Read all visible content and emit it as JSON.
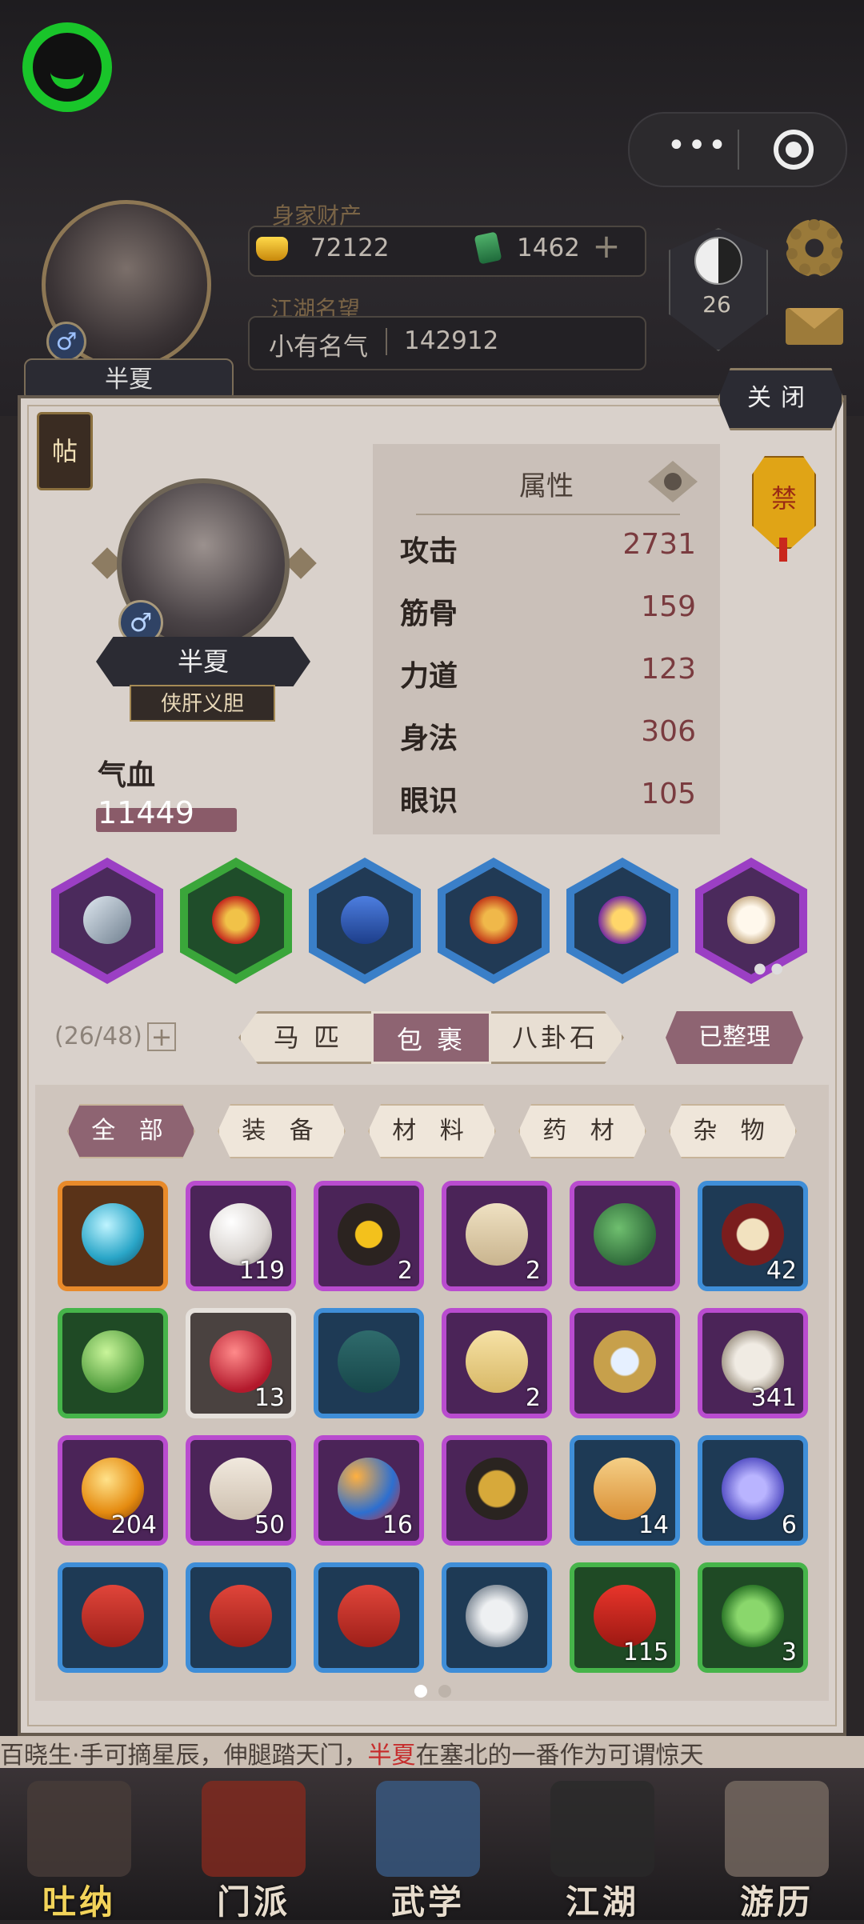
{
  "hud": {
    "assets_label": "身家财产",
    "gold": "72122",
    "jade": "1462",
    "plus": "+",
    "fame_label": "江湖名望",
    "fame_title": "小有名气",
    "fame_value": "142912",
    "player_name": "半夏",
    "gender": "♂",
    "taiji_level": "26",
    "menu_dots": "•••"
  },
  "panel": {
    "close": "关闭",
    "tie_icon": "帖",
    "ban_icon": "禁",
    "character": {
      "name": "半夏",
      "gender": "♂",
      "title": "侠肝义胆",
      "hp_label": "气血",
      "hp_value": "11449"
    },
    "attributes": {
      "title": "属性",
      "rows": [
        {
          "label": "攻击",
          "value": "2731"
        },
        {
          "label": "筋骨",
          "value": "159"
        },
        {
          "label": "力道",
          "value": "123"
        },
        {
          "label": "身法",
          "value": "306"
        },
        {
          "label": "眼识",
          "value": "105"
        }
      ]
    },
    "equipment": [
      {
        "slot": "weapon",
        "icon": "sword-icon",
        "rarity": "purple"
      },
      {
        "slot": "armor",
        "icon": "armor-icon",
        "rarity": "green"
      },
      {
        "slot": "belt",
        "icon": "belt-icon",
        "rarity": "blue"
      },
      {
        "slot": "boots",
        "icon": "boots-icon",
        "rarity": "blue"
      },
      {
        "slot": "accessory",
        "icon": "pendant-icon",
        "rarity": "blue"
      },
      {
        "slot": "mount",
        "icon": "horse-icon",
        "rarity": "purple"
      }
    ],
    "bag": {
      "count": "(26/48)",
      "add": "+",
      "tabs": [
        "马 匹",
        "包 裹",
        "八卦石"
      ],
      "active_tab": 1,
      "sorted_button": "已整理",
      "filters": [
        "全 部",
        "装 备",
        "材 料",
        "药 材",
        "杂 物"
      ],
      "active_filter": 0
    },
    "items": [
      {
        "icon": "blue-egg-icon",
        "rarity": "orange",
        "count": ""
      },
      {
        "icon": "pearl-icon",
        "rarity": "purple",
        "count": "119"
      },
      {
        "icon": "oil-jar-icon",
        "rarity": "purple",
        "count": "2"
      },
      {
        "icon": "scroll-page-icon",
        "rarity": "purple",
        "count": "2"
      },
      {
        "icon": "jade-stone-icon",
        "rarity": "purple",
        "count": ""
      },
      {
        "icon": "horse-token-icon",
        "rarity": "blue",
        "count": "42"
      },
      {
        "icon": "green-orb-icon",
        "rarity": "green",
        "count": ""
      },
      {
        "icon": "red-pouch-icon",
        "rarity": "white",
        "count": "13"
      },
      {
        "icon": "book-icon",
        "rarity": "blue",
        "count": ""
      },
      {
        "icon": "yellow-scroll-icon",
        "rarity": "purple",
        "count": "2"
      },
      {
        "icon": "mirror-pendant-icon",
        "rarity": "purple",
        "count": ""
      },
      {
        "icon": "silver-fish-icon",
        "rarity": "purple",
        "count": "341"
      },
      {
        "icon": "amber-orb-icon",
        "rarity": "purple",
        "count": "204"
      },
      {
        "icon": "letter-icon",
        "rarity": "purple",
        "count": "50"
      },
      {
        "icon": "marbles-icon",
        "rarity": "purple",
        "count": "16"
      },
      {
        "icon": "censer-icon",
        "rarity": "purple",
        "count": ""
      },
      {
        "icon": "paper-pack-icon",
        "rarity": "blue",
        "count": "14"
      },
      {
        "icon": "grapes-icon",
        "rarity": "blue",
        "count": "6"
      },
      {
        "icon": "red-book-icon",
        "rarity": "blue",
        "count": ""
      },
      {
        "icon": "red-book-icon",
        "rarity": "blue",
        "count": ""
      },
      {
        "icon": "red-book-icon",
        "rarity": "blue",
        "count": ""
      },
      {
        "icon": "silver-lantern-icon",
        "rarity": "blue",
        "count": ""
      },
      {
        "icon": "red-envelope-icon",
        "rarity": "green",
        "count": "115"
      },
      {
        "icon": "herb-leaf-icon",
        "rarity": "green",
        "count": "3"
      }
    ],
    "pages": 2,
    "active_page": 0
  },
  "marquee": {
    "before": "百晓生·手可摘星辰，伸腿踏天门，",
    "highlight": "半夏",
    "after": "在塞北的一番作为可谓惊天"
  },
  "nav": [
    {
      "label": "吐纳",
      "icon": "meditate-icon"
    },
    {
      "label": "门派",
      "icon": "sect-banner-icon"
    },
    {
      "label": "武学",
      "icon": "martial-books-icon"
    },
    {
      "label": "江湖",
      "icon": "hat-icon"
    },
    {
      "label": "游历",
      "icon": "travel-horse-icon"
    }
  ],
  "nav_active": 0,
  "colors": {
    "orange": "#e88a2a",
    "purple": "#b94ccf",
    "blue": "#3f8ed8",
    "green": "#46b44a",
    "white": "#e6e1dc",
    "accent": "#8e6472"
  }
}
